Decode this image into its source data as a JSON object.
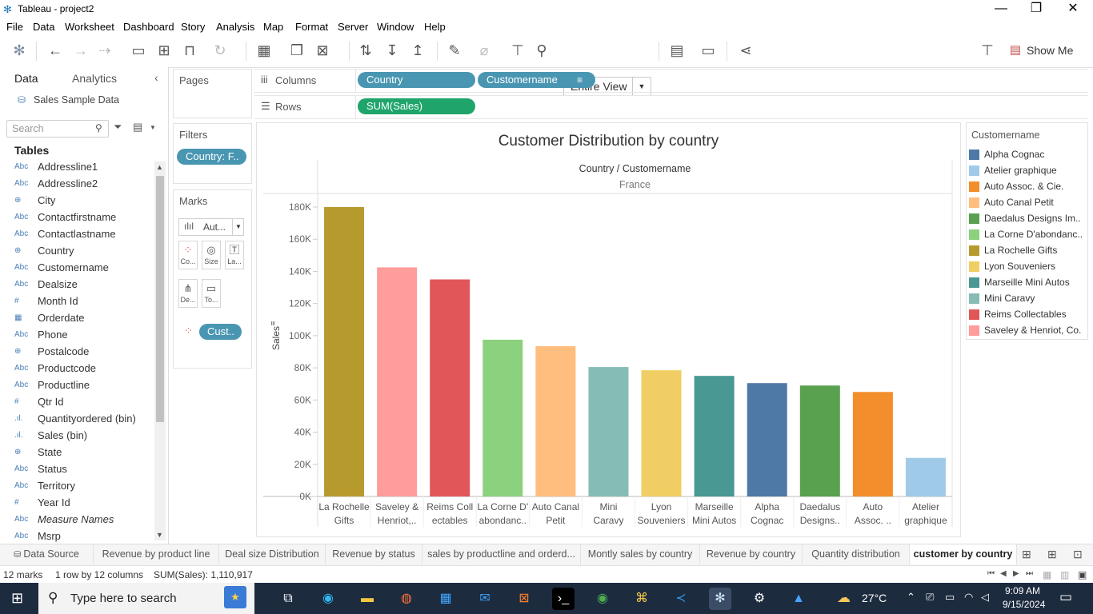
{
  "window": {
    "title": "Tableau - project2",
    "controls": {
      "minimize": "—",
      "restore": "❐",
      "close": "✕"
    }
  },
  "menu": [
    "File",
    "Data",
    "Worksheet",
    "Dashboard",
    "Story",
    "Analysis",
    "Map",
    "Format",
    "Server",
    "Window",
    "Help"
  ],
  "toolbar": {
    "fit_value": "Entire View",
    "show_me_label": "Show Me"
  },
  "data_pane": {
    "tabs": [
      "Data",
      "Analytics"
    ],
    "datasource": "Sales Sample Data",
    "search_placeholder": "Search",
    "tables_heading": "Tables",
    "fields": [
      {
        "type": "Abc",
        "name": "Addressline1"
      },
      {
        "type": "Abc",
        "name": "Addressline2"
      },
      {
        "type": "⊕",
        "name": "City"
      },
      {
        "type": "Abc",
        "name": "Contactfirstname"
      },
      {
        "type": "Abc",
        "name": "Contactlastname"
      },
      {
        "type": "⊕",
        "name": "Country"
      },
      {
        "type": "Abc",
        "name": "Customername"
      },
      {
        "type": "Abc",
        "name": "Dealsize"
      },
      {
        "type": "#",
        "name": "Month Id"
      },
      {
        "type": "▦",
        "name": "Orderdate"
      },
      {
        "type": "Abc",
        "name": "Phone"
      },
      {
        "type": "⊕",
        "name": "Postalcode"
      },
      {
        "type": "Abc",
        "name": "Productcode"
      },
      {
        "type": "Abc",
        "name": "Productline"
      },
      {
        "type": "#",
        "name": "Qtr Id"
      },
      {
        "type": ".ıl.",
        "name": "Quantityordered (bin)"
      },
      {
        "type": ".ıl.",
        "name": "Sales (bin)"
      },
      {
        "type": "⊕",
        "name": "State"
      },
      {
        "type": "Abc",
        "name": "Status"
      },
      {
        "type": "Abc",
        "name": "Territory"
      },
      {
        "type": "#",
        "name": "Year Id"
      },
      {
        "type": "Abc",
        "name": "Measure Names"
      },
      {
        "type": "Abc",
        "name": "Msrp"
      }
    ]
  },
  "cards": {
    "pages_title": "Pages",
    "filters_title": "Filters",
    "filter_pill": "Country: F..",
    "marks_title": "Marks",
    "mark_type": "Aut...",
    "mark_buttons": [
      "Co...",
      "Size",
      "La...",
      "De...",
      "To..."
    ],
    "color_pill": "Cust.."
  },
  "shelves": {
    "columns_label": "Columns",
    "rows_label": "Rows",
    "columns_pills": [
      "Country",
      "Customername"
    ],
    "rows_pills": [
      "SUM(Sales)"
    ]
  },
  "viz": {
    "title": "Customer Distribution  by country",
    "header_line1": "Country / Customername",
    "header_line2": "France",
    "y_axis_label": "Sales"
  },
  "chart_data": {
    "type": "bar",
    "title": "Customer Distribution  by country",
    "xlabel": "Country / Customername",
    "ylabel": "Sales",
    "ylim": [
      0,
      180000
    ],
    "y_ticks": [
      "180K",
      "160K",
      "140K",
      "120K",
      "100K",
      "80K",
      "60K",
      "40K",
      "20K",
      "0K"
    ],
    "categories": [
      [
        "La Rochelle",
        "Gifts"
      ],
      [
        "Saveley &",
        "Henriot,.."
      ],
      [
        "Reims Coll",
        "ectables"
      ],
      [
        "La Corne D'",
        "abondanc.."
      ],
      [
        "Auto Canal",
        "Petit"
      ],
      [
        "Mini",
        "Caravy"
      ],
      [
        "Lyon",
        "Souveniers"
      ],
      [
        "Marseille",
        "Mini Autos"
      ],
      [
        "Alpha",
        "Cognac"
      ],
      [
        "Daedalus",
        "Designs.."
      ],
      [
        "Auto",
        "Assoc. .."
      ],
      [
        "Atelier",
        "graphique"
      ]
    ],
    "values": [
      180000,
      142500,
      135000,
      97500,
      93500,
      80500,
      78500,
      75000,
      70500,
      69000,
      65000,
      24000
    ],
    "colors": [
      "#b69a2e",
      "#ff9c9c",
      "#e15759",
      "#8cd17d",
      "#ffbe7d",
      "#86bcb6",
      "#f1ce63",
      "#499894",
      "#4e79a7",
      "#59a14f",
      "#f28e2b",
      "#a0cbe8"
    ],
    "total_label": "SUM(Sales): 1,110,917"
  },
  "legend": {
    "title": "Customername",
    "items": [
      {
        "label": "Alpha Cognac",
        "color": "#4e79a7"
      },
      {
        "label": "Atelier graphique",
        "color": "#a0cbe8"
      },
      {
        "label": "Auto Assoc. & Cie.",
        "color": "#f28e2b"
      },
      {
        "label": "Auto Canal Petit",
        "color": "#ffbe7d"
      },
      {
        "label": "Daedalus Designs Im..",
        "color": "#59a14f"
      },
      {
        "label": "La Corne D'abondanc..",
        "color": "#8cd17d"
      },
      {
        "label": "La Rochelle Gifts",
        "color": "#b69a2e"
      },
      {
        "label": "Lyon Souveniers",
        "color": "#f1ce63"
      },
      {
        "label": "Marseille Mini Autos",
        "color": "#499894"
      },
      {
        "label": "Mini Caravy",
        "color": "#86bcb6"
      },
      {
        "label": "Reims Collectables",
        "color": "#e15759"
      },
      {
        "label": "Saveley & Henriot, Co.",
        "color": "#ff9d9a"
      }
    ]
  },
  "sheet_tabs": {
    "datasource": "Data Source",
    "tabs": [
      "Revenue by product line",
      "Deal size Distribution",
      "Revenue by status",
      "sales by productline and orderd...",
      "Montly sales by country",
      "Revenue by country",
      "Quantity distribution",
      "customer by country"
    ],
    "active": "customer by country"
  },
  "status": {
    "marks": "12 marks",
    "shape": "1 row by 12 columns",
    "sum": "SUM(Sales): 1,110,917"
  },
  "taskbar": {
    "search_placeholder": "Type here to search",
    "weather": "27°C",
    "time": "9:09 AM",
    "date": "9/15/2024"
  }
}
